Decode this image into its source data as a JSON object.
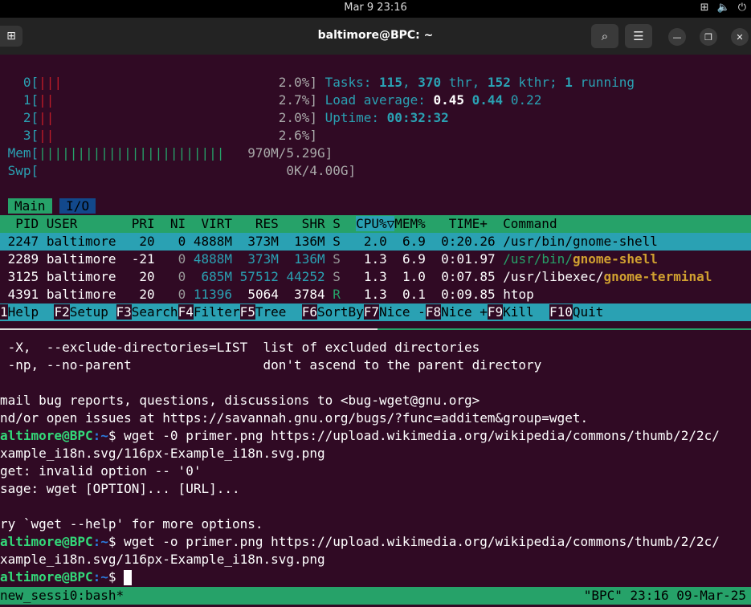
{
  "topbar": {
    "clock": "Mar 9  23:16",
    "tray_icons": [
      "network-icon",
      "volume-icon",
      "power-icon"
    ]
  },
  "titlebar": {
    "title": "baltimore@BPC: ~"
  },
  "htop": {
    "cpus": [
      {
        "label": "0[",
        "bars": "|||",
        "pct": "2.0%]"
      },
      {
        "label": "1[",
        "bars": "||",
        "pct": "2.7%]"
      },
      {
        "label": "2[",
        "bars": "||",
        "pct": "2.0%]"
      },
      {
        "label": "3[",
        "bars": "||",
        "pct": "2.6%]"
      }
    ],
    "mem": {
      "label": "Mem[",
      "bars": "||||||||||||||||||||||||",
      "value": "970M/5.29G]"
    },
    "swp": {
      "label": "Swp[",
      "value": "0K/4.00G]"
    },
    "tasks": {
      "prefix": "Tasks: ",
      "tasks": "115",
      "sep1": ", ",
      "thr": "370",
      "mid": " thr, ",
      "kthr": "152",
      "mid2": " kthr; ",
      "running": "1",
      "suffix": " running"
    },
    "load": {
      "prefix": "Load average: ",
      "l1": "0.45",
      "l5": "0.44",
      "l15": "0.22"
    },
    "uptime": {
      "prefix": "Uptime: ",
      "value": "00:32:32"
    },
    "tabs": {
      "main": "Main",
      "io": "I/O"
    },
    "header": {
      "left": "  PID USER       PRI  NI  VIRT   RES   SHR S  ",
      "sorted": "CPU%▽",
      "right": "MEM%   TIME+  Command"
    },
    "rows": [
      {
        "pid": " 2247",
        "user": "baltimore",
        "pri": "20",
        "ni": "0",
        "virt": "4888M",
        "res": "373M",
        "shr": "136M",
        "s": "S",
        "cpu": "2.0",
        "mem": "6.9",
        "time": "0:20.26",
        "cmd_path": "/usr/bin/gnome-shell",
        "cmd_name": ""
      },
      {
        "pid": " 2289",
        "user": "baltimore",
        "pri": "-21",
        "ni": "0",
        "virt": "4888M",
        "res": "373M",
        "shr": "136M",
        "s": "S",
        "cpu": "1.3",
        "mem": "6.9",
        "time": "0:01.97",
        "cmd_path": "/usr/bin/",
        "cmd_name": "gnome-shell"
      },
      {
        "pid": " 3125",
        "user": "baltimore",
        "pri": "20",
        "ni": "0",
        "virt": "685M",
        "res": "57512",
        "shr": "44252",
        "s": "S",
        "cpu": "1.3",
        "mem": "1.0",
        "time": "0:07.85",
        "cmd_path": "/usr/libexec/",
        "cmd_name": "gnome-terminal"
      },
      {
        "pid": " 4391",
        "user": "baltimore",
        "pri": "20",
        "ni": "0",
        "virt": "11396",
        "res": "5064",
        "shr": "3784",
        "s": "R",
        "cpu": "1.3",
        "mem": "0.1",
        "time": "0:09.85",
        "cmd_path": "htop",
        "cmd_name": ""
      }
    ],
    "fkeys": [
      {
        "key": "1",
        "label": "Help  "
      },
      {
        "key": "F2",
        "label": "Setup "
      },
      {
        "key": "F3",
        "label": "Search"
      },
      {
        "key": "F4",
        "label": "Filter"
      },
      {
        "key": "F5",
        "label": "Tree  "
      },
      {
        "key": "F6",
        "label": "SortBy"
      },
      {
        "key": "F7",
        "label": "Nice -"
      },
      {
        "key": "F8",
        "label": "Nice +"
      },
      {
        "key": "F9",
        "label": "Kill  "
      },
      {
        "key": "F10",
        "label": "Quit  "
      }
    ]
  },
  "shell": {
    "lines": [
      " -X,  --exclude-directories=LIST  list of excluded directories",
      " -np, --no-parent                 don't ascend to the parent directory",
      "",
      "mail bug reports, questions, discussions to <bug-wget@gnu.org>",
      "nd/or open issues at https://savannah.gnu.org/bugs/?func=additem&group=wget."
    ],
    "cmd1": {
      "user": "altimore@BPC",
      "path": ":~",
      "cmd": "$ wget -0 primer.png https://upload.wikimedia.org/wikipedia/commons/thumb/2/2c/"
    },
    "cmd1_cont": "xample_i18n.svg/116px-Example_i18n.svg.png",
    "err1": "get: invalid option -- '0'",
    "err2": "sage: wget [OPTION]... [URL]...",
    "err3": "ry `wget --help' for more options.",
    "cmd2": {
      "user": "altimore@BPC",
      "path": ":~",
      "cmd": "$ wget -o primer.png https://upload.wikimedia.org/wikipedia/commons/thumb/2/2c/"
    },
    "cmd2_cont": "xample_i18n.svg/116px-Example_i18n.svg.png",
    "cmd3": {
      "user": "altimore@BPC",
      "path": ":~",
      "cmd": "$ "
    }
  },
  "tmux": {
    "left": "new_sessi0:bash*",
    "right": "\"BPC\" 23:16 09-Mar-25"
  }
}
